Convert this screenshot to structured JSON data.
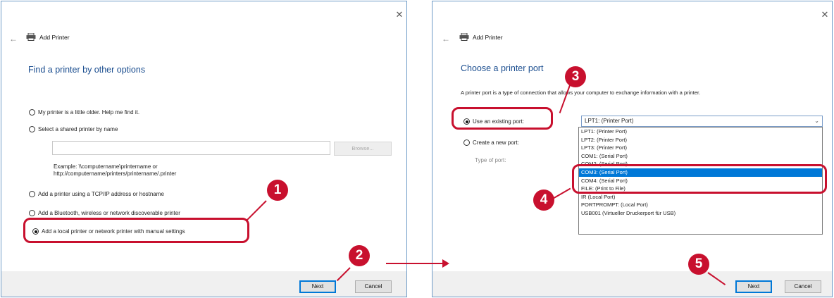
{
  "left_dialog": {
    "title": "Add Printer",
    "heading": "Find a printer by other options",
    "options": [
      "My printer is a little older. Help me find it.",
      "Select a shared printer by name",
      "Add a printer using a TCP/IP address or hostname",
      "Add a Bluetooth, wireless or network discoverable printer",
      "Add a local printer or network printer with manual settings"
    ],
    "selected_option": 4,
    "shared_name_value": "",
    "browse_label": "Browse...",
    "example_line1": "Example: \\\\computername\\printername or",
    "example_line2": "http://computername/printers/printername/.printer",
    "next_label": "Next",
    "cancel_label": "Cancel"
  },
  "right_dialog": {
    "title": "Add Printer",
    "heading": "Choose a printer port",
    "description": "A printer port is a type of connection that allows your computer to exchange information with a printer.",
    "use_existing_label": "Use an existing port:",
    "create_new_label": "Create a new port:",
    "type_of_port_label": "Type of port:",
    "selected_port": "LPT1: (Printer Port)",
    "port_options": [
      "LPT1: (Printer Port)",
      "LPT2: (Printer Port)",
      "LPT3: (Printer Port)",
      "COM1: (Serial Port)",
      "COM2: (Serial Port)",
      "COM3: (Serial Port)",
      "COM4: (Serial Port)",
      "FILE: (Print to File)",
      "IR (Local Port)",
      "PORTPROMPT: (Local Port)",
      "USB001 (Virtueller Druckerport für USB)"
    ],
    "highlighted_option": 5,
    "next_label": "Next",
    "cancel_label": "Cancel"
  },
  "markers": [
    "1",
    "2",
    "3",
    "4",
    "5"
  ],
  "icons": {
    "close": "close-icon",
    "back": "back-arrow-icon",
    "printer": "printer-icon",
    "dropdown": "chevron-down-icon"
  },
  "colors": {
    "accent": "#0078d7",
    "heading": "#1a4d8f",
    "callout": "#c8102e"
  }
}
